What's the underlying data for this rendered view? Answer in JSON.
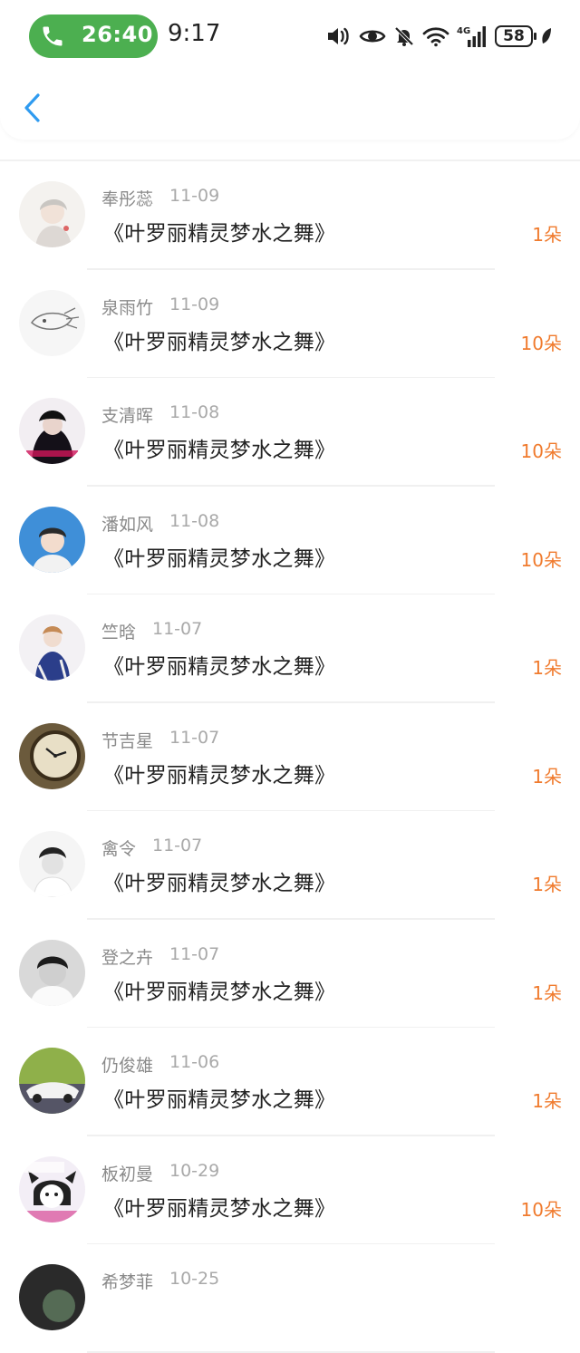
{
  "status_bar": {
    "call_timer": "26:40",
    "clock": "9:17",
    "network": "4G",
    "battery": "58"
  },
  "nav": {
    "back_icon": "chevron-left-icon"
  },
  "colors": {
    "accent_blue": "#2f9bf0",
    "count_orange": "#f07b2e",
    "call_green": "#4caf50"
  },
  "items": [
    {
      "name": "奉彤蕊",
      "date": "11-09",
      "title": "《叶罗丽精灵梦水之舞》",
      "count": "1朵"
    },
    {
      "name": "泉雨竹",
      "date": "11-09",
      "title": "《叶罗丽精灵梦水之舞》",
      "count": "10朵"
    },
    {
      "name": "支清晖",
      "date": "11-08",
      "title": "《叶罗丽精灵梦水之舞》",
      "count": "10朵"
    },
    {
      "name": "潘如风",
      "date": "11-08",
      "title": "《叶罗丽精灵梦水之舞》",
      "count": "10朵"
    },
    {
      "name": "竺晗",
      "date": "11-07",
      "title": "《叶罗丽精灵梦水之舞》",
      "count": "1朵"
    },
    {
      "name": "节吉星",
      "date": "11-07",
      "title": "《叶罗丽精灵梦水之舞》",
      "count": "1朵"
    },
    {
      "name": "禽令",
      "date": "11-07",
      "title": "《叶罗丽精灵梦水之舞》",
      "count": "1朵"
    },
    {
      "name": "登之卉",
      "date": "11-07",
      "title": "《叶罗丽精灵梦水之舞》",
      "count": "1朵"
    },
    {
      "name": "仍俊雄",
      "date": "11-06",
      "title": "《叶罗丽精灵梦水之舞》",
      "count": "1朵"
    },
    {
      "name": "板初曼",
      "date": "10-29",
      "title": "《叶罗丽精灵梦水之舞》",
      "count": "10朵"
    },
    {
      "name": "希梦菲",
      "date": "10-25",
      "title": "",
      "count": ""
    }
  ]
}
